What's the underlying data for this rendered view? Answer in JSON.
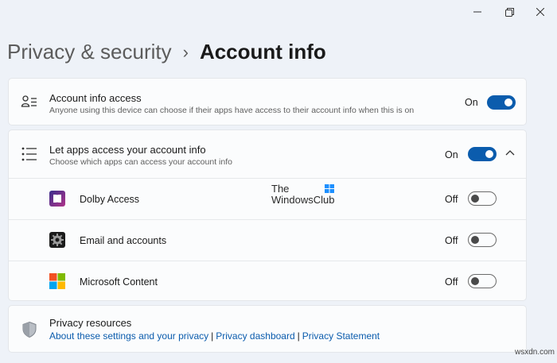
{
  "window": {
    "controls": [
      "minimize-icon",
      "maximize-icon",
      "close-icon"
    ]
  },
  "breadcrumb": {
    "parent": "Privacy & security",
    "separator": "›",
    "current": "Account info"
  },
  "account_info_access": {
    "title": "Account info access",
    "subtitle": "Anyone using this device can choose if their apps have access to their account info when this is on",
    "state": "On",
    "enabled": true,
    "icon": "person-list-icon"
  },
  "let_apps": {
    "title": "Let apps access your account info",
    "subtitle": "Choose which apps can access your account info",
    "state": "On",
    "enabled": true,
    "icon": "list-icon",
    "expanded": true
  },
  "apps": [
    {
      "name": "Dolby Access",
      "state": "Off",
      "enabled": false,
      "icon": "dolby-icon"
    },
    {
      "name": "Email and accounts",
      "state": "Off",
      "enabled": false,
      "icon": "gear-icon"
    },
    {
      "name": "Microsoft Content",
      "state": "Off",
      "enabled": false,
      "icon": "microsoft-logo-icon"
    }
  ],
  "privacy_resources": {
    "title": "Privacy resources",
    "icon": "shield-icon",
    "links": [
      "About these settings and your privacy",
      "Privacy dashboard",
      "Privacy Statement"
    ],
    "separator": "|"
  },
  "watermark": {
    "line1": "The",
    "line2": "WindowsClub"
  },
  "corner_watermark": "wsxdn.com",
  "colors": {
    "accent": "#0b5cad",
    "background": "#eef2f8",
    "card": "#fbfcfd"
  }
}
